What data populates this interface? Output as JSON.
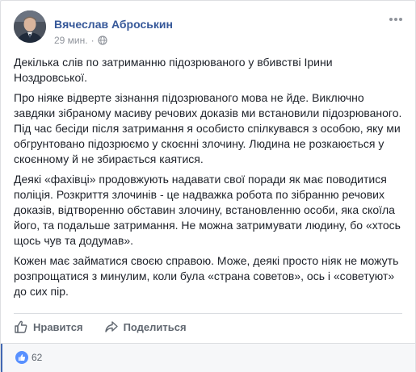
{
  "post": {
    "author": "Вячеслав Аброськин",
    "time": "29 мин.",
    "audience_icon": "globe-icon",
    "paragraphs": [
      "Декілька слів по затриманню підозрюваного у вбивстві Ірини Ноздровської.",
      "Про ніяке відверте зізнання підозрюваного мова не йде. Виключно завдяки зібраному масиву речових доказів ми встановили підозрюваного. Під час бесіди після затримання я особисто спілкувався з особою, яку ми обгрунтовано підозрюємо у скоєнні злочину. Людина не розкаюється у скоєнному й не збирається каятися.",
      "Деякі «фахівці» продовжують надавати свої поради як має поводитися поліція. Розкриття злочинів - це надважка робота по зібранню речових доказів, відтворенню обставин злочину, встановленню особи, яка скоїла його, та подальше затримання. Не можна затримувати людину, бо «хтось щось чув та додумав».",
      "Кожен має займатися своєю справою. Може, деякі просто ніяк не можуть розпрощатися з минулим, коли була «страна советов», ось і «советуют» до сих пір."
    ]
  },
  "actions": {
    "like_label": "Нравится",
    "share_label": "Поделиться"
  },
  "reactions": {
    "count": "62"
  },
  "colors": {
    "link_blue": "#365899",
    "like_blue": "#5890ff",
    "muted_gray": "#90949c",
    "text": "#1d2129"
  }
}
